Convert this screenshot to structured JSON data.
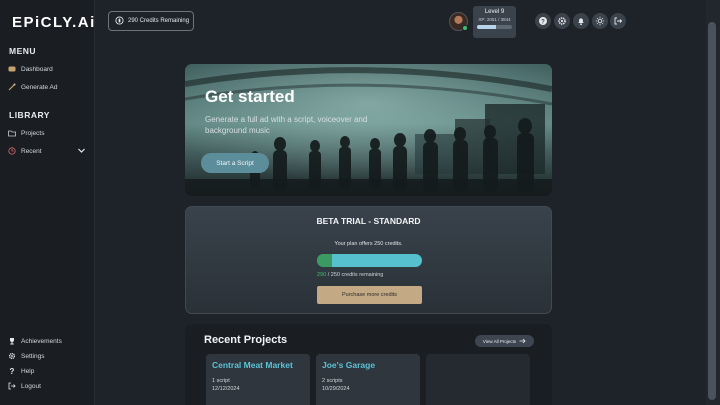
{
  "app": {
    "logo": "EPiCLY.Ai"
  },
  "sidebar": {
    "menu_heading": "MENU",
    "menu_items": [
      {
        "label": "Dashboard",
        "icon": "dashboard-icon"
      },
      {
        "label": "Generate Ad",
        "icon": "wand-icon"
      }
    ],
    "library_heading": "LIBRARY",
    "library_items": [
      {
        "label": "Projects",
        "icon": "folder-icon"
      },
      {
        "label": "Recent",
        "icon": "clock-icon"
      }
    ],
    "bottom_items": [
      {
        "label": "Achievements",
        "icon": "trophy-icon"
      },
      {
        "label": "Settings",
        "icon": "gear-icon"
      },
      {
        "label": "Help",
        "icon": "question-icon"
      },
      {
        "label": "Logout",
        "icon": "logout-icon"
      }
    ]
  },
  "header": {
    "credits_label": "290 Credits Remaining",
    "level": {
      "title": "Level 9",
      "xp_text": "XP: 2051 / 3844",
      "xp_current": 2051,
      "xp_max": 3844
    },
    "icons": [
      "help-icon",
      "settings-icon",
      "notifications-icon",
      "theme-icon",
      "logout-icon"
    ]
  },
  "hero": {
    "title": "Get started",
    "subtitle": "Generate a full ad with a script, voiceover and background music",
    "button": "Start a Script"
  },
  "plan": {
    "title": "BETA TRIAL - STANDARD",
    "offer_text": "Your plan offers 250 credits.",
    "remaining_num": "290",
    "remaining_rest": " / 250 credits remaining",
    "used_fraction": 0.14,
    "buy_button": "Purchase more credits",
    "colors": {
      "used": "#3b9a62",
      "remaining": "#56c0cf",
      "button": "#c4a985"
    }
  },
  "recent": {
    "title": "Recent Projects",
    "view_all": "View All Projects",
    "projects": [
      {
        "name": "Central Meat Market",
        "scripts": "1 script",
        "date": "12/12/2024"
      },
      {
        "name": "Joe's Garage",
        "scripts": "2 scripts",
        "date": "10/29/2024"
      }
    ]
  }
}
